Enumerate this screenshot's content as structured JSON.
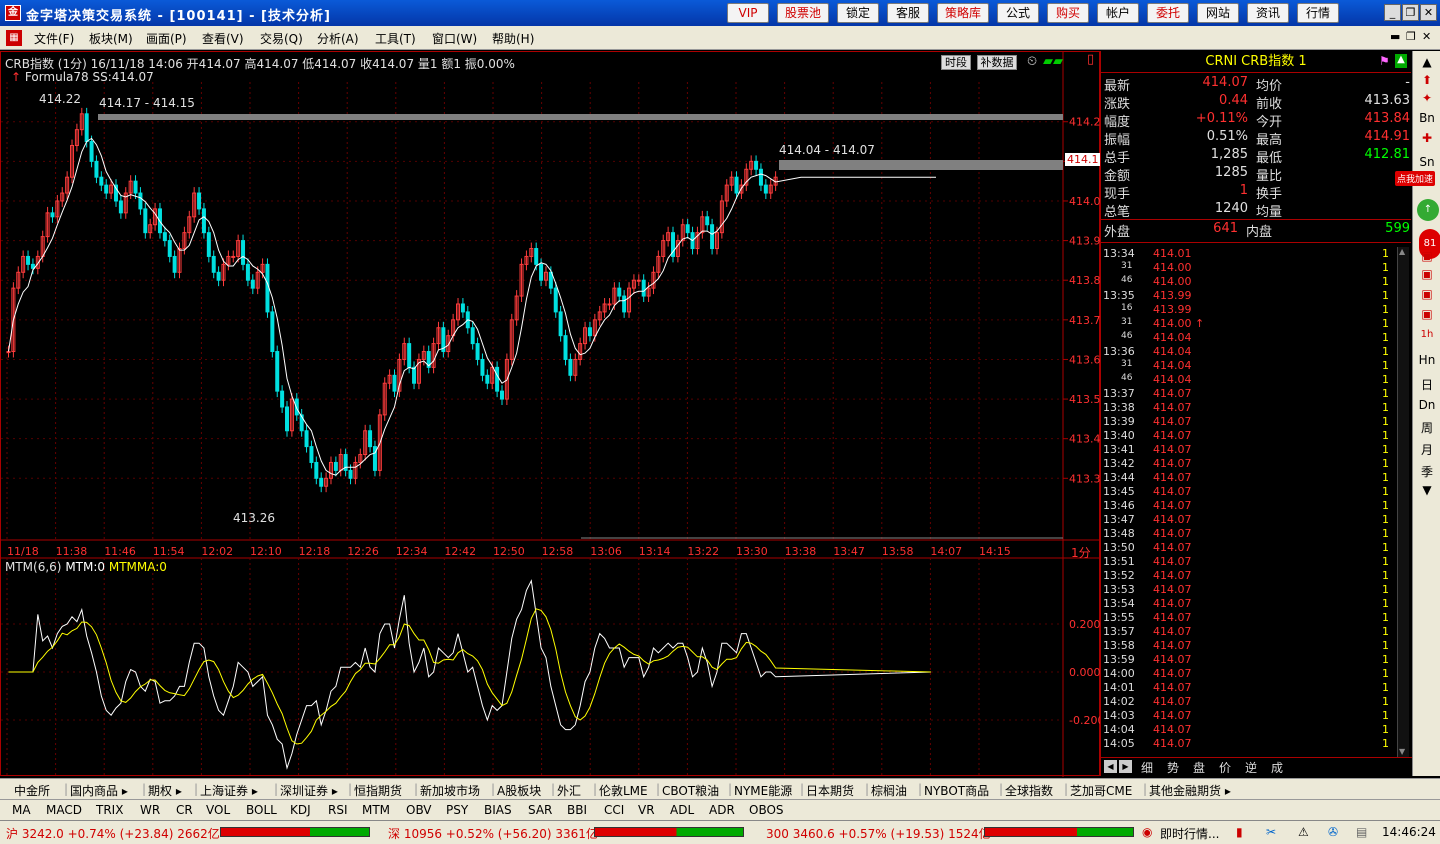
{
  "window": {
    "title": "金字塔决策交易系统 - [100141] - [技术分析]"
  },
  "toolbar": {
    "buttons": [
      {
        "label": "VIP",
        "color": "red"
      },
      {
        "label": "股票池",
        "color": "red"
      },
      {
        "label": "锁定",
        "color": "black"
      },
      {
        "label": "客服",
        "color": "black"
      },
      {
        "label": "策略库",
        "color": "red"
      },
      {
        "label": "公式",
        "color": "black"
      },
      {
        "label": "购买",
        "color": "red"
      },
      {
        "label": "帐户",
        "color": "black"
      },
      {
        "label": "委托",
        "color": "red"
      },
      {
        "label": "网站",
        "color": "black"
      },
      {
        "label": "资讯",
        "color": "black"
      },
      {
        "label": "行情",
        "color": "black"
      }
    ]
  },
  "menu": {
    "items": [
      "文件(F)",
      "板块(M)",
      "画面(P)",
      "查看(V)",
      "交易(Q)",
      "分析(A)",
      "工具(T)",
      "窗口(W)",
      "帮助(H)"
    ]
  },
  "chart": {
    "info": "CRB指数 (1分) 16/11/18 14:06 开414.07 高414.07 低414.07 收414.07 量1 额1 振0.00%",
    "formula": "Formula78 SS:414.07",
    "pill_timeframe": "时段",
    "pill_supp": "补数据",
    "hi_label": "414.22",
    "range1": "414.17 - 414.15",
    "range2": "414.04 - 414.07",
    "lo_label": "413.26",
    "price_tag": "414.1",
    "period_label": "1分",
    "mtm_title": "MTM(6,6)",
    "mtm_val": "MTM:0",
    "mtmma_val": "MTMMA:0"
  },
  "chart_data": [
    {
      "type": "candlestick",
      "title": "CRB指数 (1分)",
      "ylim": [
        413.22,
        414.27
      ],
      "y_ticks": [
        "414.2",
        "414.1",
        "414.0",
        "413.9",
        "413.8",
        "413.7",
        "413.6",
        "413.5",
        "413.4",
        "413.3"
      ],
      "x_ticks": [
        "11/18",
        "11:38",
        "11:46",
        "11:54",
        "12:02",
        "12:10",
        "12:18",
        "12:26",
        "12:34",
        "12:42",
        "12:50",
        "12:58",
        "13:06",
        "13:14",
        "13:22",
        "13:30",
        "13:38",
        "13:47",
        "13:58",
        "14:07",
        "14:15"
      ],
      "close": [
        413.62,
        413.78,
        413.82,
        413.86,
        413.84,
        413.83,
        413.86,
        413.91,
        413.97,
        413.96,
        414.0,
        414.02,
        414.06,
        414.14,
        414.18,
        414.22,
        414.15,
        414.1,
        414.06,
        414.04,
        414.02,
        414.04,
        414.0,
        413.97,
        414.02,
        414.05,
        414.02,
        413.98,
        413.92,
        413.94,
        413.98,
        413.92,
        413.9,
        413.86,
        413.82,
        413.88,
        413.92,
        413.96,
        414.02,
        413.98,
        413.92,
        413.86,
        413.82,
        413.8,
        413.84,
        413.86,
        413.86,
        413.9,
        413.84,
        413.8,
        413.78,
        413.82,
        413.84,
        413.72,
        413.62,
        413.52,
        413.48,
        413.42,
        413.5,
        413.46,
        413.42,
        413.38,
        413.34,
        413.3,
        413.28,
        413.3,
        413.34,
        413.32,
        413.36,
        413.32,
        413.3,
        413.34,
        413.36,
        413.42,
        413.38,
        413.32,
        413.46,
        413.54,
        413.56,
        413.52,
        413.6,
        413.64,
        413.58,
        413.54,
        413.6,
        413.62,
        413.58,
        413.64,
        413.68,
        413.62,
        413.66,
        413.7,
        413.74,
        413.72,
        413.68,
        413.64,
        413.6,
        413.56,
        413.54,
        413.58,
        413.52,
        413.5,
        413.6,
        413.7,
        413.76,
        413.84,
        413.86,
        413.88,
        413.84,
        413.8,
        413.82,
        413.78,
        413.72,
        413.66,
        413.6,
        413.56,
        413.6,
        413.64,
        413.68,
        413.66,
        413.7,
        413.72,
        413.74,
        413.74,
        413.78,
        413.76,
        413.72,
        413.78,
        413.8,
        413.8,
        413.76,
        413.78,
        413.82,
        413.86,
        413.9,
        413.92,
        413.86,
        413.9,
        413.94,
        413.92,
        413.88,
        413.92,
        413.96,
        413.94,
        413.88,
        413.92,
        414.0,
        414.04,
        414.06,
        414.02,
        414.04,
        414.08,
        414.1,
        414.08,
        414.04,
        414.02,
        414.04,
        414.06
      ],
      "volume": [],
      "mtm": {
        "ylim": [
          -0.4,
          0.4
        ],
        "ticks": [
          "0.200",
          "0.000",
          "-0.200"
        ],
        "series": [
          {
            "name": "MTM",
            "color": "#ffffff"
          },
          {
            "name": "MTMMA",
            "color": "#ffff00"
          }
        ]
      }
    },
    {
      "type": "table",
      "title": "分时明细",
      "columns": [
        "time",
        "price",
        "volume"
      ]
    }
  ],
  "quote": {
    "title": "CRNI  CRB指数  1",
    "rows": [
      {
        "l1": "最新",
        "v1": "414.07",
        "c1": "#ff3030",
        "l2": "均价",
        "v2": "-",
        "c2": "#e0e0e0"
      },
      {
        "l1": "涨跌",
        "v1": "0.44",
        "c1": "#ff3030",
        "l2": "前收",
        "v2": "413.63",
        "c2": "#e0e0e0"
      },
      {
        "l1": "幅度",
        "v1": "+0.11%",
        "c1": "#ff3030",
        "l2": "今开",
        "v2": "413.84",
        "c2": "#ff3030"
      },
      {
        "l1": "振幅",
        "v1": "0.51%",
        "c1": "#e0e0e0",
        "l2": "最高",
        "v2": "414.91",
        "c2": "#ff3030"
      },
      {
        "l1": "总手",
        "v1": "1,285",
        "c1": "#e0e0e0",
        "l2": "最低",
        "v2": "412.81",
        "c2": "#00ff00"
      },
      {
        "l1": "金额",
        "v1": "1285",
        "c1": "#e0e0e0",
        "l2": "量比",
        "v2": "",
        "c2": "#e0e0e0"
      },
      {
        "l1": "现手",
        "v1": "1",
        "c1": "#ff3030",
        "l2": "换手",
        "v2": "",
        "c2": "#e0e0e0"
      },
      {
        "l1": "总笔",
        "v1": "1240",
        "c1": "#e0e0e0",
        "l2": "均量",
        "v2": "",
        "c2": "#e0e0e0"
      }
    ],
    "outer_label": "外盘",
    "outer_val": "641",
    "inner_label": "内盘",
    "inner_val": "599"
  },
  "ticks": [
    {
      "t": "13:34",
      "p": "414.01",
      "v": "1"
    },
    {
      "t": "31",
      "p": "414.00",
      "v": "1"
    },
    {
      "t": "46",
      "p": "414.00",
      "v": "1"
    },
    {
      "t": "13:35",
      "p": "413.99",
      "v": "1"
    },
    {
      "t": "16",
      "p": "413.99",
      "v": "1"
    },
    {
      "t": "31",
      "p": "414.00 ↑",
      "v": "1"
    },
    {
      "t": "46",
      "p": "414.04",
      "v": "1"
    },
    {
      "t": "13:36",
      "p": "414.04",
      "v": "1"
    },
    {
      "t": "31",
      "p": "414.04",
      "v": "1"
    },
    {
      "t": "46",
      "p": "414.04",
      "v": "1"
    },
    {
      "t": "13:37",
      "p": "414.07",
      "v": "1"
    },
    {
      "t": "13:38",
      "p": "414.07",
      "v": "1"
    },
    {
      "t": "13:39",
      "p": "414.07",
      "v": "1"
    },
    {
      "t": "13:40",
      "p": "414.07",
      "v": "1"
    },
    {
      "t": "13:41",
      "p": "414.07",
      "v": "1"
    },
    {
      "t": "13:42",
      "p": "414.07",
      "v": "1"
    },
    {
      "t": "13:44",
      "p": "414.07",
      "v": "1"
    },
    {
      "t": "13:45",
      "p": "414.07",
      "v": "1"
    },
    {
      "t": "13:46",
      "p": "414.07",
      "v": "1"
    },
    {
      "t": "13:47",
      "p": "414.07",
      "v": "1"
    },
    {
      "t": "13:48",
      "p": "414.07",
      "v": "1"
    },
    {
      "t": "13:50",
      "p": "414.07",
      "v": "1"
    },
    {
      "t": "13:51",
      "p": "414.07",
      "v": "1"
    },
    {
      "t": "13:52",
      "p": "414.07",
      "v": "1"
    },
    {
      "t": "13:53",
      "p": "414.07",
      "v": "1"
    },
    {
      "t": "13:54",
      "p": "414.07",
      "v": "1"
    },
    {
      "t": "13:55",
      "p": "414.07",
      "v": "1"
    },
    {
      "t": "13:57",
      "p": "414.07",
      "v": "1"
    },
    {
      "t": "13:58",
      "p": "414.07",
      "v": "1"
    },
    {
      "t": "13:59",
      "p": "414.07",
      "v": "1"
    },
    {
      "t": "14:00",
      "p": "414.07",
      "v": "1"
    },
    {
      "t": "14:01",
      "p": "414.07",
      "v": "1"
    },
    {
      "t": "14:02",
      "p": "414.07",
      "v": "1"
    },
    {
      "t": "14:03",
      "p": "414.07",
      "v": "1"
    },
    {
      "t": "14:04",
      "p": "414.07",
      "v": "1"
    },
    {
      "t": "14:05",
      "p": "414.07",
      "v": "1"
    }
  ],
  "detail_tabs": [
    "细",
    "势",
    "盘",
    "价",
    "逆",
    "成"
  ],
  "sidebar": {
    "icons": [
      "Bn",
      "Sn",
      "点我加速",
      "81",
      "Hn",
      "日",
      "Dn",
      "周",
      "月",
      "季"
    ]
  },
  "market_tabs": [
    "中金所",
    "国内商品 ▸",
    "期权 ▸",
    "上海证券 ▸",
    "深圳证券 ▸",
    "恒指期货",
    "新加坡市场",
    "A股板块",
    "外汇",
    "伦敦LME",
    "CBOT粮油",
    "NYME能源",
    "日本期货",
    "棕榈油",
    "NYBOT商品",
    "全球指数",
    "芝加哥CME",
    "其他金融期货 ▸"
  ],
  "indicator_tabs": [
    "MA",
    "MACD",
    "TRIX",
    "WR",
    "CR",
    "VOL",
    "BOLL",
    "KDJ",
    "RSI",
    "MTM",
    "OBV",
    "PSY",
    "BIAS",
    "SAR",
    "BBI",
    "CCI",
    "VR",
    "ADL",
    "ADR",
    "OBOS"
  ],
  "status": {
    "sh": "沪 3242.0 +0.74% (+23.84) 2662亿",
    "sz": "深 10956 +0.52% (+56.20) 3361亿",
    "hs300": "300 3460.6 +0.57% (+19.53) 1524亿",
    "news": "即时行情...",
    "clock": "14:46:24"
  }
}
